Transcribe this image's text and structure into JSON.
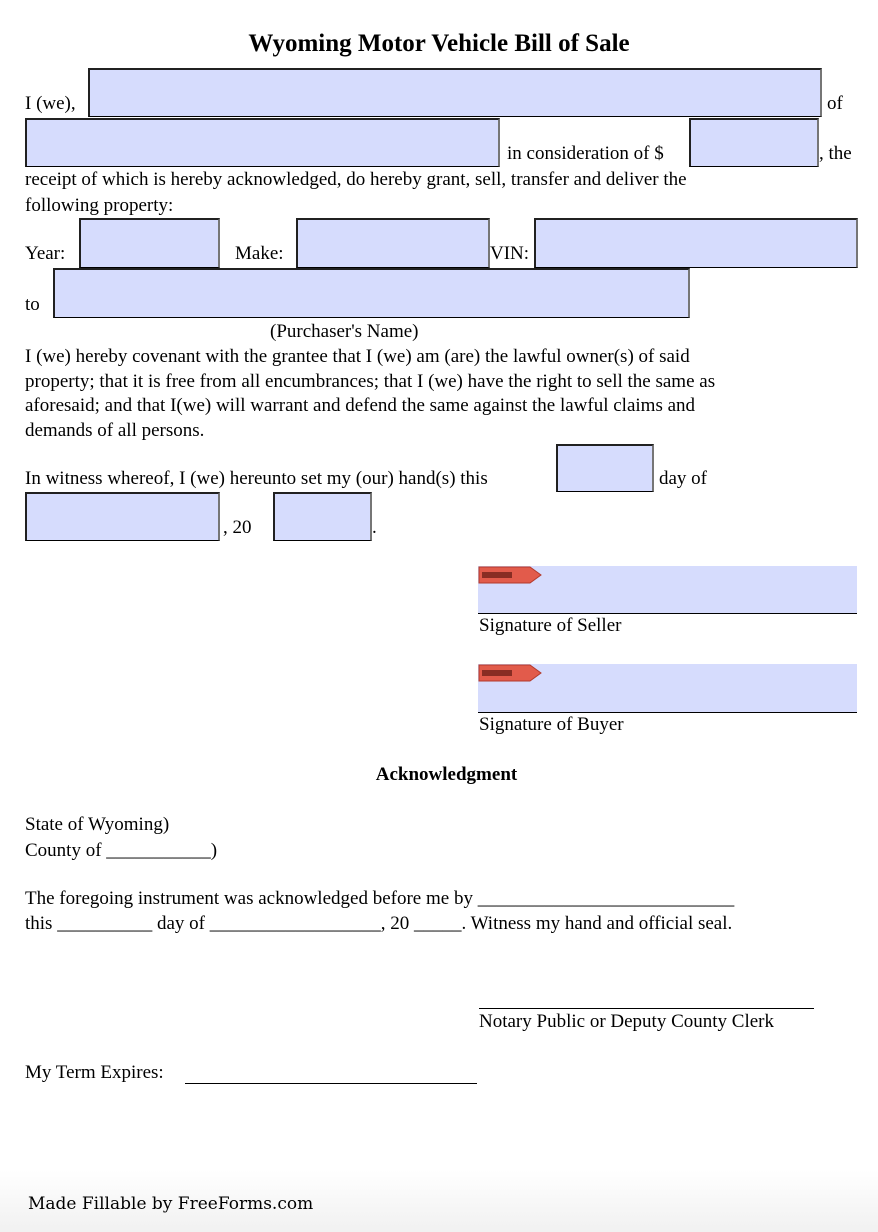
{
  "document": {
    "title": "Wyoming Motor Vehicle Bill of Sale",
    "field_color": "#d6dcfd"
  },
  "seller_section": {
    "i_we_label": "I (we),",
    "of_label": "of",
    "consideration_label": "in consideration of  $",
    "the_label": ", the",
    "receipt_text_line1": "receipt of which is hereby acknowledged, do hereby grant, sell, transfer and deliver the",
    "receipt_text_line2": "following property:",
    "seller_name_value": "",
    "seller_address_value": "",
    "amount_value": ""
  },
  "vehicle": {
    "year_label": "Year:",
    "make_label": "Make:",
    "vin_label": "VIN:",
    "year_value": "",
    "make_value": "",
    "vin_value": ""
  },
  "purchaser": {
    "to_label": "to",
    "caption": "(Purchaser's Name)",
    "name_value": ""
  },
  "covenant": {
    "lines": [
      "I (we) hereby covenant with the grantee that I (we) am (are) the lawful owner(s) of said",
      "property; that it is free from all encumbrances; that I (we) have the right to sell the same as",
      "aforesaid; and that I(we) will warrant and defend the same against the lawful claims and",
      "demands of all persons."
    ]
  },
  "witness": {
    "text": "In witness whereof, I (we) hereunto set my (our) hand(s) this",
    "day_of_label": "day of",
    "year_prefix": ", 20",
    "period": ".",
    "day_value": "",
    "month_value": "",
    "year_value": ""
  },
  "signatures": {
    "sign_here_badge": "SIGN HERE",
    "seller_label": "Signature of Seller",
    "buyer_label": "Signature of Buyer"
  },
  "acknowledgment": {
    "heading": "Acknowledgment",
    "state_line": "State of Wyoming)",
    "county_line": "County of ___________)",
    "foregoing_line": "The foregoing instrument was acknowledged before me by ___________________________",
    "this_line": "this __________ day of __________________, 20 _____. Witness my hand and official seal.",
    "notary_label": "Notary Public or Deputy County Clerk",
    "term_label": "My Term Expires:"
  },
  "footer": {
    "credit": "Made Fillable by FreeForms.com"
  }
}
